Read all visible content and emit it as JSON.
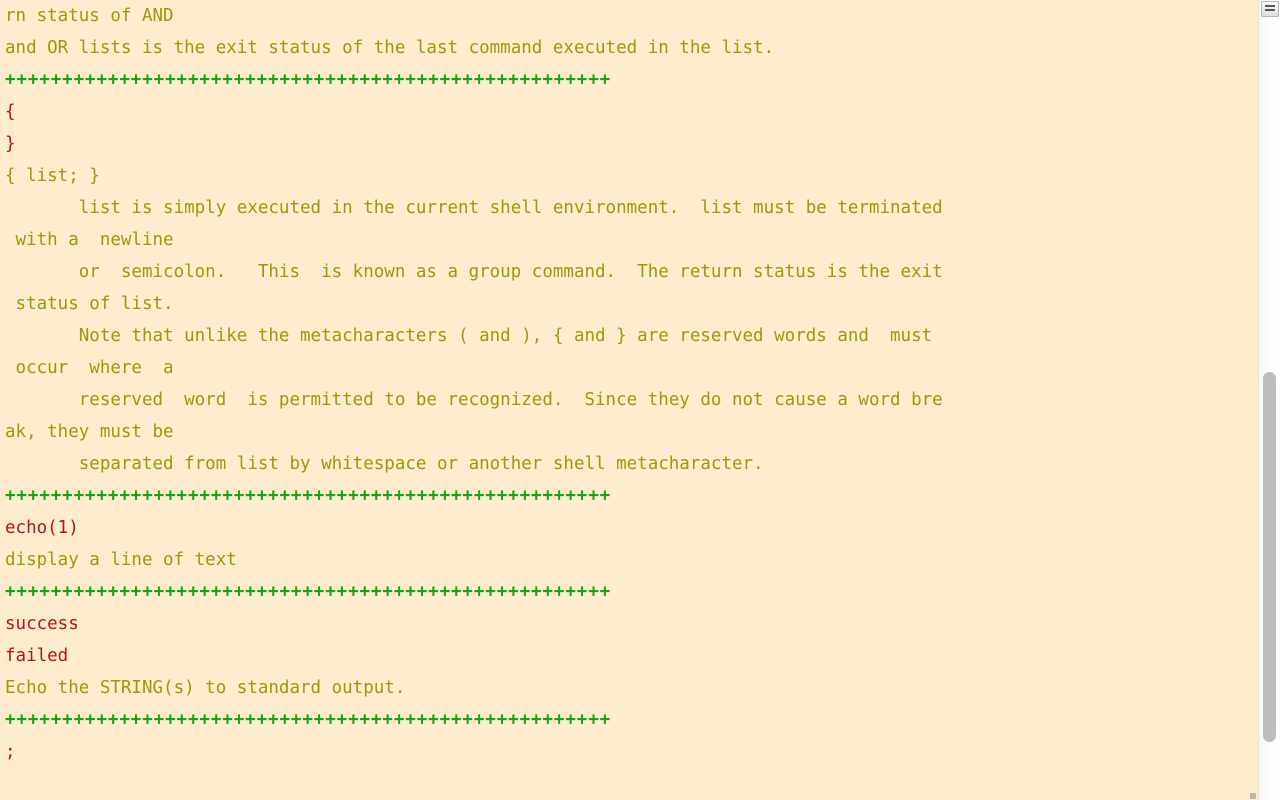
{
  "window": {
    "title": "bash manual page output",
    "background_color": "#fdeccd",
    "text_color_normal": "#9a9a09",
    "text_color_highlight": "#b01616",
    "text_color_separator": "#14a514"
  },
  "scrollbar": {
    "grip_label": "scrollbar-grip",
    "thumb_label": "scrollbar-thumb",
    "track_label": "scrollbar-track"
  },
  "terminal": {
    "lines": [
      {
        "id": "l01",
        "color": "olive",
        "text": "rn status of AND"
      },
      {
        "id": "l02",
        "color": "olive",
        "text": "and OR lists is the exit status of the last command executed in the list."
      },
      {
        "id": "l03",
        "color": "green",
        "text": "+++++++++++++++++++++++++++++++++++++++++++++++++++++"
      },
      {
        "id": "l04",
        "color": "red",
        "text": "{"
      },
      {
        "id": "l05",
        "color": "red",
        "text": "}"
      },
      {
        "id": "l06",
        "color": "olive",
        "text": "{ list; }"
      },
      {
        "id": "l07",
        "color": "olive",
        "text": "       list is simply executed in the current shell environment.  list must be terminated"
      },
      {
        "id": "l08",
        "color": "olive",
        "text": " with a  newline"
      },
      {
        "id": "l09",
        "color": "olive",
        "text": "       or  semicolon.   This  is known as a group command.  The return status is the exit"
      },
      {
        "id": "l10",
        "color": "olive",
        "text": " status of list."
      },
      {
        "id": "l11",
        "color": "olive",
        "text": "       Note that unlike the metacharacters ( and ), { and } are reserved words and  must"
      },
      {
        "id": "l12",
        "color": "olive",
        "text": " occur  where  a"
      },
      {
        "id": "l13",
        "color": "olive",
        "text": "       reserved  word  is permitted to be recognized.  Since they do not cause a word bre"
      },
      {
        "id": "l14",
        "color": "olive",
        "text": "ak, they must be"
      },
      {
        "id": "l15",
        "color": "olive",
        "text": "       separated from list by whitespace or another shell metacharacter."
      },
      {
        "id": "l16",
        "color": "green",
        "text": "+++++++++++++++++++++++++++++++++++++++++++++++++++++"
      },
      {
        "id": "l17",
        "color": "red",
        "text": "echo(1)"
      },
      {
        "id": "l18",
        "color": "olive",
        "text": "display a line of text"
      },
      {
        "id": "l19",
        "color": "green",
        "text": "+++++++++++++++++++++++++++++++++++++++++++++++++++++"
      },
      {
        "id": "l20",
        "color": "red",
        "text": "success"
      },
      {
        "id": "l21",
        "color": "red",
        "text": "failed"
      },
      {
        "id": "l22",
        "color": "olive",
        "text": "Echo the STRING(s) to standard output."
      },
      {
        "id": "l23",
        "color": "green",
        "text": "+++++++++++++++++++++++++++++++++++++++++++++++++++++"
      },
      {
        "id": "l24",
        "color": "red",
        "text": ";"
      }
    ]
  }
}
